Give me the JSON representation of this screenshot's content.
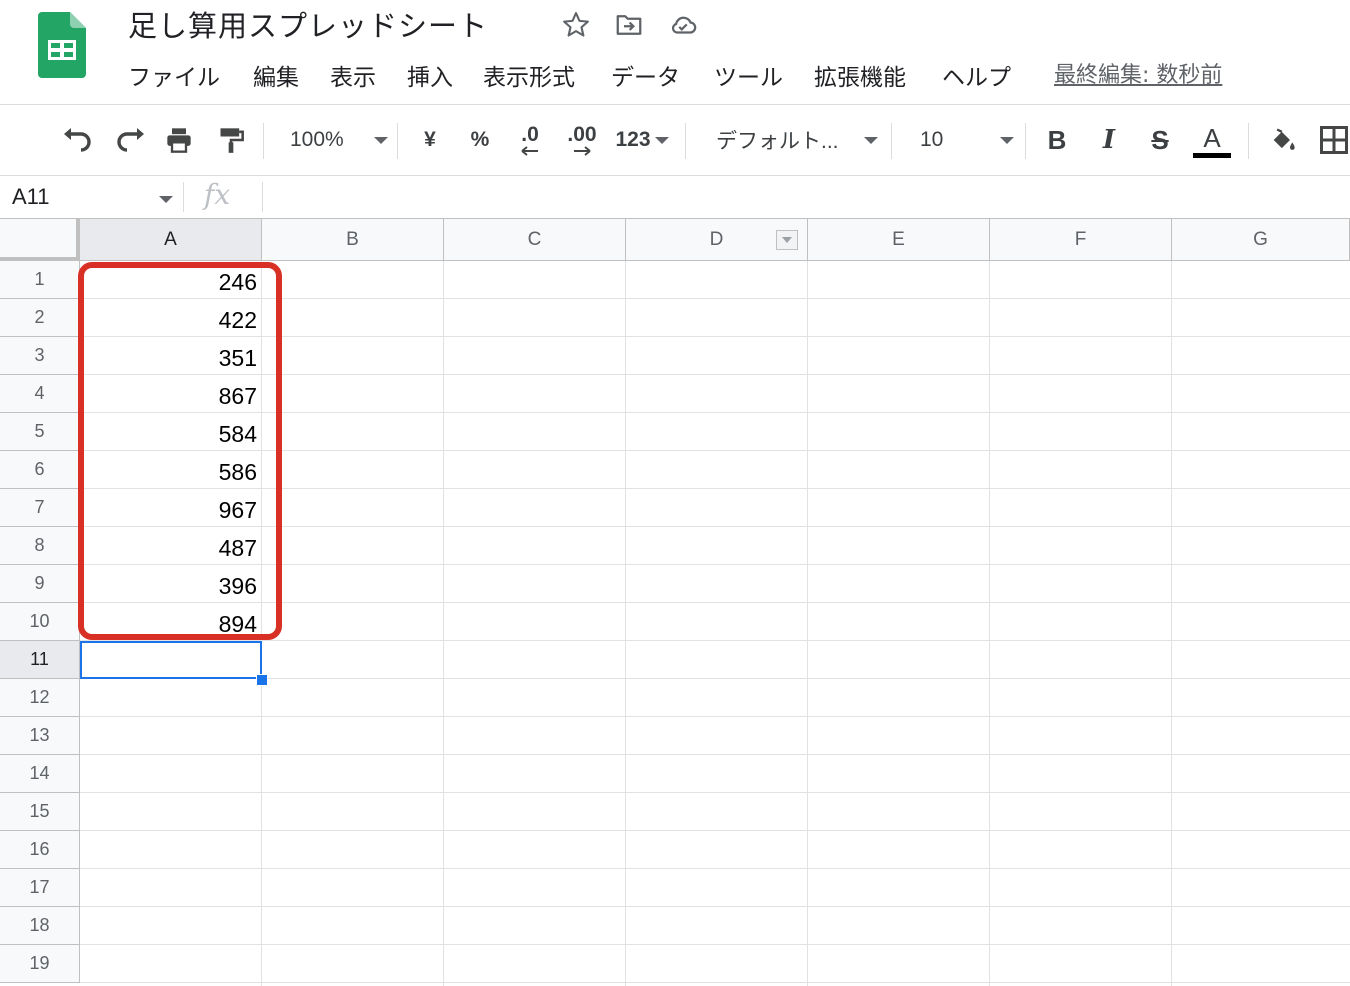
{
  "app": {
    "title": "足し算用スプレッドシート",
    "last_edit": "最終編集: 数秒前",
    "logo_color": "#0f9d58"
  },
  "menu": {
    "items": [
      "ファイル",
      "編集",
      "表示",
      "挿入",
      "表示形式",
      "データ",
      "ツール",
      "拡張機能",
      "ヘルプ"
    ]
  },
  "toolbar": {
    "zoom": "100%",
    "currency": "¥",
    "percent": "%",
    "decrease_decimal": ".0",
    "increase_decimal": ".00",
    "number_format": "123",
    "font": "デフォルト...",
    "font_size": "10",
    "bold": "B",
    "italic": "I",
    "strikethrough": "S",
    "text_color": "A"
  },
  "formula_bar": {
    "cell_ref": "A11",
    "fx": "fx"
  },
  "grid": {
    "columns": [
      "A",
      "B",
      "C",
      "D",
      "E",
      "F",
      "G"
    ],
    "rows": [
      "1",
      "2",
      "3",
      "4",
      "5",
      "6",
      "7",
      "8",
      "9",
      "10",
      "11",
      "12",
      "13",
      "14",
      "15",
      "16",
      "17",
      "18",
      "19"
    ],
    "column_a_values": [
      "246",
      "422",
      "351",
      "867",
      "584",
      "586",
      "967",
      "487",
      "396",
      "894"
    ],
    "selected_cell": "A11",
    "highlight_color": "#d93025",
    "selection_color": "#1a73e8"
  }
}
